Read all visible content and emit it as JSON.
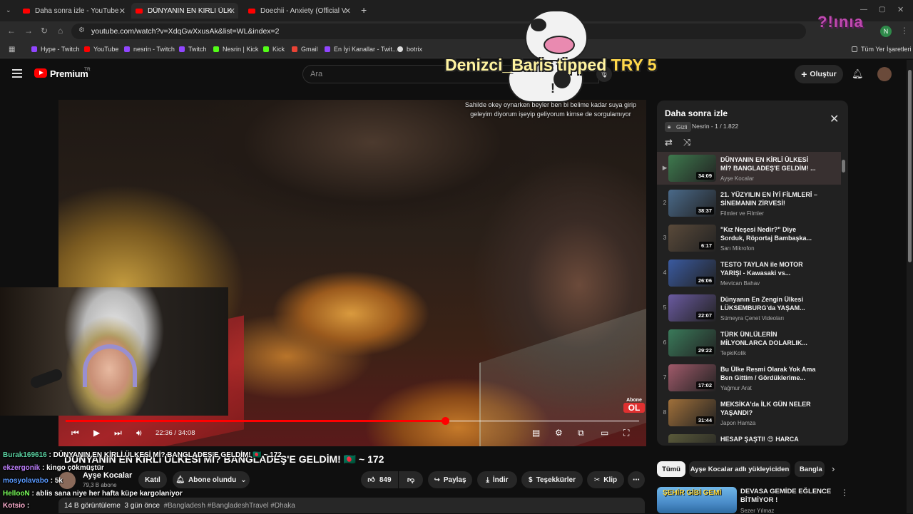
{
  "browser": {
    "tabs": [
      {
        "title": "Daha sonra izle - YouTube",
        "active": false
      },
      {
        "title": "DÜNYANIN EN KİRLİ ÜLKESİ Mİ",
        "active": true
      },
      {
        "title": "Doechii - Anxiety (Official Vide",
        "active": false
      }
    ],
    "url": "youtube.com/watch?v=XdqGwXxusAk&list=WL&index=2",
    "bookmarks": [
      "Hype - Twitch",
      "YouTube",
      "nesrin - Twitch",
      "Twitch",
      "Nesrin | Kick",
      "Kick",
      "Gmail",
      "En İyi Kanallar - Twit...",
      "botrix"
    ],
    "bookmarks_all": "Tüm Yer İşaretleri"
  },
  "youtube": {
    "logo_text": "Premium",
    "logo_badge": "TR",
    "search_placeholder": "Ara",
    "create_label": "Oluştur"
  },
  "overlay": {
    "tipper": "Denizci_Baris",
    "tip_word": "tipped",
    "tip_amount": "TRY 5",
    "subtitle": "Sahilde okey oynarken beyler ben bi belime kadar suya girip geleyim diyorum işeyip geliyorum kimse de sorgulamıyor",
    "streamer_logo": "?!ınıa"
  },
  "player": {
    "current_time": "22:36",
    "duration": "34:08",
    "progress": 0.662,
    "watermark_top": "Abone",
    "watermark_bottom": "OL"
  },
  "video": {
    "title": "DÜNYANIN EN KİRLİ ÜLKESİ Mİ? BANGLADEŞ'E GELDİM! 🇧🇩 ~ 172",
    "channel": "Ayşe Kocalar",
    "subscribers": "79,3 B abone",
    "join_label": "Katıl",
    "subscribed_label": "Abone olundu",
    "likes": "849",
    "share_label": "Paylaş",
    "download_label": "İndir",
    "thanks_label": "Teşekkürler",
    "clip_label": "Klip",
    "views": "14 B görüntüleme",
    "time_ago": "3 gün önce",
    "tags": "#Bangladesh #BangladeshTravel #Dhaka"
  },
  "playlist": {
    "title": "Daha sonra izle",
    "privacy": "Gizli",
    "owner": "Nesrin",
    "position": "1 / 1.822",
    "items": [
      {
        "index": "▶",
        "title": "DÜNYANIN EN KİRLİ ÜLKESİ Mİ? BANGLADEŞ'E GELDİM! ...",
        "channel": "Ayşe Kocalar",
        "duration": "34:09",
        "color": "#3e7a4e"
      },
      {
        "index": "2",
        "title": "21. YÜZYILIN EN İYİ FİLMLERİ – SİNEMANIN ZİRVESİ!",
        "channel": "Filmler ve Filmler",
        "duration": "38:37",
        "color": "#4a6a8a"
      },
      {
        "index": "3",
        "title": "\"Kız Neşesi Nedir?\" Diye Sorduk, Röportaj Bambaşka...",
        "channel": "Sarı Mikrofon",
        "duration": "6:17",
        "color": "#5a4a3a"
      },
      {
        "index": "4",
        "title": "TESTO TAYLAN ile MOTOR YARIŞI - Kawasaki vs...",
        "channel": "Mevtcan Bahav",
        "duration": "26:06",
        "color": "#3a5aa0"
      },
      {
        "index": "5",
        "title": "Dünyanın En Zengin Ülkesi LÜKSEMBURG'da YAŞAM...",
        "channel": "Sümeyra Çenet Videoları",
        "duration": "22:07",
        "color": "#6a5aa0"
      },
      {
        "index": "6",
        "title": "TÜRK ÜNLÜLERİN MİLYONLARCA DOLARLIK...",
        "channel": "TepkiKolik",
        "duration": "29:22",
        "color": "#3a7a5a"
      },
      {
        "index": "7",
        "title": "Bu Ülke Resmi Olarak Yok Ama Ben Gittim / Gördüklerime...",
        "channel": "Yağmur Arat",
        "duration": "17:02",
        "color": "#a05a6a"
      },
      {
        "index": "8",
        "title": "MEKSİKA'da İLK GÜN NELER YAŞANDI?",
        "channel": "Japon Hamza",
        "duration": "31:44",
        "color": "#a0703a"
      },
      {
        "index": "",
        "title": "HESAP ŞAŞTI! 😍 HARCA",
        "channel": "",
        "duration": "",
        "color": "#5a5a3a"
      }
    ]
  },
  "chat": [
    {
      "user": "Burak169616",
      "color": "#5ad0a0",
      "message": "DÜNYANIN EN KİRLİ ÜLKESİ Mİ? BANGLADEŞ'E GELDİM! 🇧🇩 ~ 172"
    },
    {
      "user": "ekzergonik",
      "color": "#c080ff",
      "message": "kingo çökmüştür"
    },
    {
      "user": "mosyolavabo",
      "color": "#5a9aff",
      "message": "5k"
    },
    {
      "user": "HellooN",
      "color": "#7aff5a",
      "message": "ablis sana niye her hafta küpe kargolaniyor"
    },
    {
      "user": "Kotsio",
      "color": "#ffb0d0",
      "message": ""
    }
  ],
  "recommendations": {
    "chips": [
      "Tümü",
      "Ayşe Kocalar adlı yükleyiciden",
      "Bangla"
    ],
    "first": {
      "thumb_text": "ŞEHİR GİBİ GEMİ",
      "title": "DEVASA GEMİDE EĞLENCE BİTMİYOR !",
      "channel": "Sezer Yılmaz"
    }
  }
}
